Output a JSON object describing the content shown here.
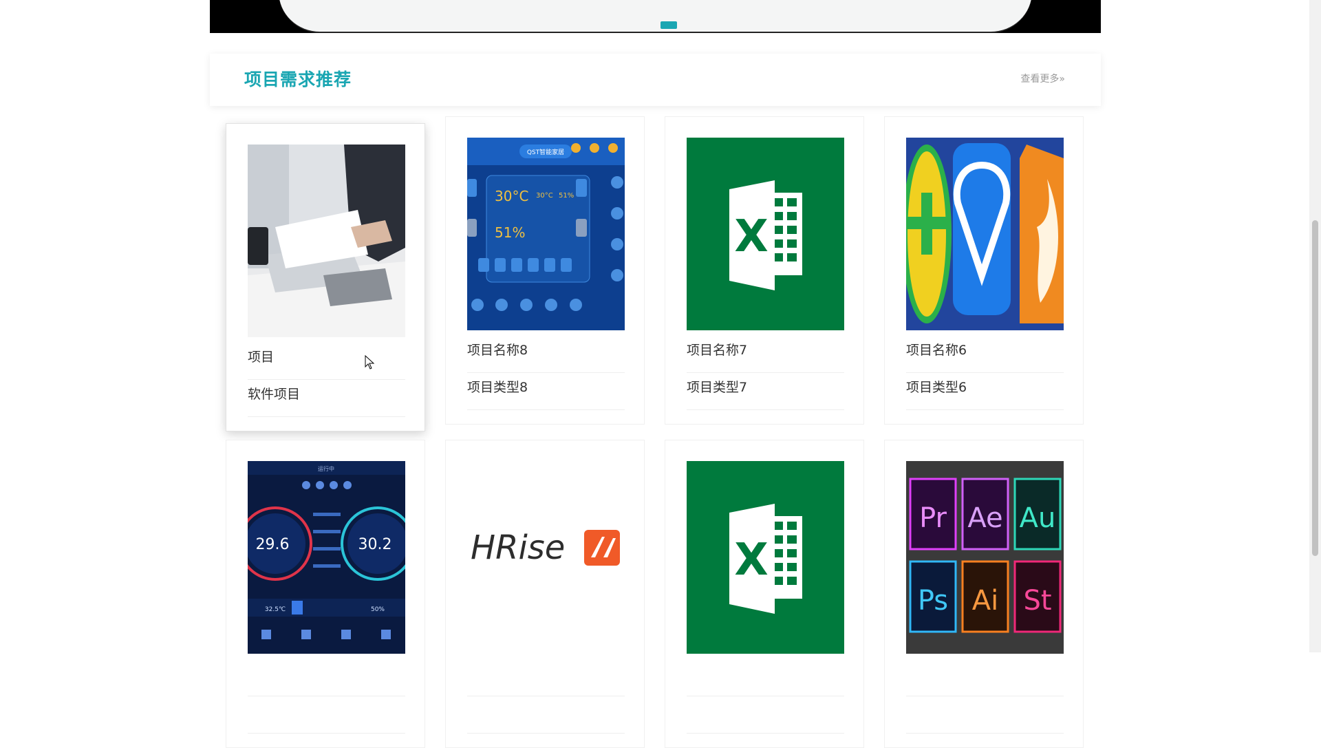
{
  "section": {
    "title": "项目需求推荐",
    "more_label": "查看更多»"
  },
  "projects": [
    {
      "name": "项目",
      "type": "软件项目",
      "image": "office-laptop-photo"
    },
    {
      "name": "项目名称8",
      "type": "项目类型8",
      "image": "smart-home-panel"
    },
    {
      "name": "项目名称7",
      "type": "项目类型7",
      "image": "excel-logo"
    },
    {
      "name": "项目名称6",
      "type": "项目类型6",
      "image": "app-icons-collage"
    },
    {
      "name": "",
      "type": "",
      "image": "car-climate-dashboard"
    },
    {
      "name": "",
      "type": "",
      "image": "hrise-logo"
    },
    {
      "name": "",
      "type": "",
      "image": "excel-logo"
    },
    {
      "name": "",
      "type": "",
      "image": "adobe-apps-grid"
    }
  ],
  "image_text": {
    "smart_home_brand": "QST智能家居",
    "smart_home_temp": "30°C",
    "smart_home_temp_small": "30°C",
    "smart_home_humidity": "51%",
    "smart_home_humidity_small": "51%",
    "climate_left_temp": "29.6",
    "climate_right_temp": "30.2",
    "climate_left_set": "32.5℃",
    "climate_right_set": "50%",
    "climate_status": "运行中",
    "hrise_text": "HRise",
    "adobe_pr": "Pr",
    "adobe_ae": "Ae",
    "adobe_au": "Au",
    "adobe_ps": "Ps",
    "adobe_ai": "Ai",
    "adobe_st": "St",
    "excel_letter": "X"
  },
  "colors": {
    "accent": "#1aa6b2",
    "excel_green": "#007a3d"
  }
}
